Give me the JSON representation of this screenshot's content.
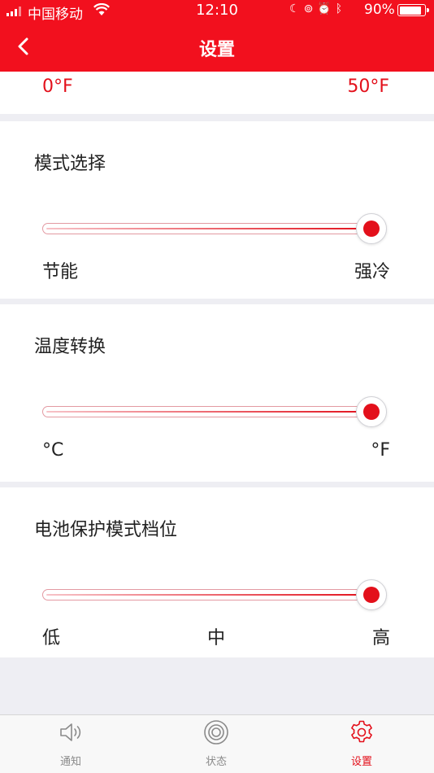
{
  "status_bar": {
    "carrier": "中国移动",
    "time": "12:10",
    "icons": [
      "moon-icon",
      "rotation-lock-icon",
      "alarm-icon",
      "bluetooth-icon"
    ],
    "battery_percent": "90%",
    "battery_level": 0.9
  },
  "nav": {
    "title": "设置"
  },
  "temperature_range": {
    "min_label": "0°F",
    "max_label": "50°F"
  },
  "sections": [
    {
      "label": "模式选择",
      "value": 1.0,
      "ticks": [
        "节能",
        "",
        "强冷"
      ]
    },
    {
      "label": "温度转换",
      "value": 1.0,
      "ticks": [
        "°C",
        "",
        "°F"
      ]
    },
    {
      "label": "电池保护模式档位",
      "value": 1.0,
      "ticks": [
        "低",
        "中",
        "高"
      ]
    }
  ],
  "tabs": [
    {
      "label": "通知",
      "icon": "speaker-icon",
      "active": false
    },
    {
      "label": "状态",
      "icon": "status-ring-icon",
      "active": false
    },
    {
      "label": "设置",
      "icon": "gear-icon",
      "active": true
    }
  ],
  "colors": {
    "brand_red": "#f2101e",
    "accent_red": "#e3101b",
    "background": "#eeeef3"
  }
}
